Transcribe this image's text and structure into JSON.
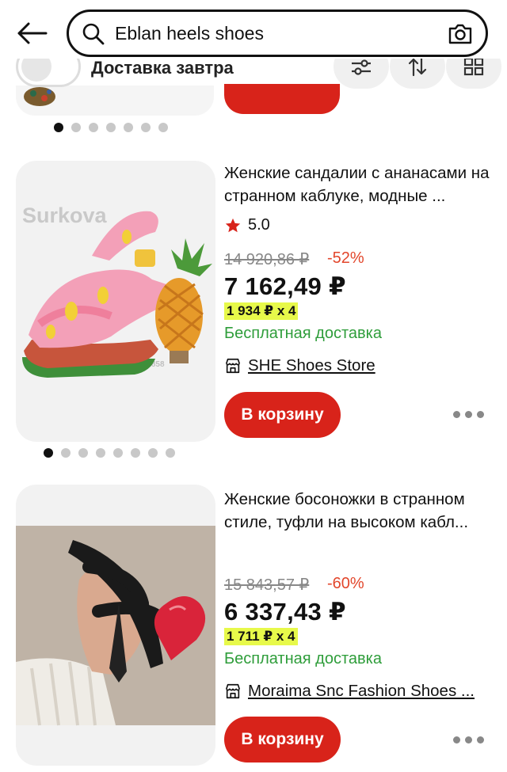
{
  "search": {
    "query": "Eblan heels shoes"
  },
  "filters": {
    "delivery_label": "Доставка завтра",
    "delivery_enabled": false
  },
  "products": [
    {
      "title": "Женские сандалии с ананасами на странном каблуке, модные ...",
      "rating": "5.0",
      "old_price": "14 920,86 ₽",
      "discount": "-52%",
      "price": "7 162,49 ₽",
      "installment": "1 934 ₽ x 4",
      "shipping": "Бесплатная доставка",
      "store": "SHE Shoes Store",
      "cart_label": "В корзину",
      "image_watermark": "Surkova",
      "image_store_mark": "Store No.1102471858",
      "image_dots": 8,
      "image_active_dot": 0
    },
    {
      "title": "Женские босоножки в странном стиле, туфли на высоком кабл...",
      "old_price": "15 843,57 ₽",
      "discount": "-60%",
      "price": "6 337,43 ₽",
      "installment": "1 711 ₽ x 4",
      "shipping": "Бесплатная доставка",
      "store": "Moraima Snc Fashion Shoes ...",
      "cart_label": "В корзину"
    }
  ],
  "previous_card": {
    "image_dots": 7,
    "image_active_dot": 0
  },
  "colors": {
    "accent_red": "#d8231a",
    "discount_red": "#e2462b",
    "free_ship_green": "#2e9d3a",
    "installment_highlight": "#e7f94a",
    "rating_star": "#d8231a"
  }
}
